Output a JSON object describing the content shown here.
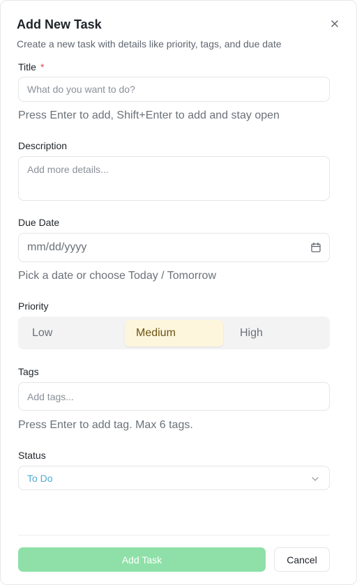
{
  "dialog": {
    "title": "Add New Task",
    "subtitle": "Create a new task with details like priority, tags, and due date"
  },
  "title_field": {
    "label": "Title",
    "required_marker": "*",
    "placeholder": "What do you want to do?",
    "hint": "Press Enter to add, Shift+Enter to add and stay open"
  },
  "description_field": {
    "label": "Description",
    "placeholder": "Add more details..."
  },
  "due_date_field": {
    "label": "Due Date",
    "placeholder": "mm/dd/yyyy",
    "hint": "Pick a date or choose Today / Tomorrow",
    "icon": "calendar-icon"
  },
  "priority": {
    "label": "Priority",
    "options": [
      "Low",
      "Medium",
      "High"
    ],
    "selected": "Medium"
  },
  "tags_field": {
    "label": "Tags",
    "placeholder": "Add tags...",
    "hint": "Press Enter to add tag. Max 6 tags."
  },
  "status_field": {
    "label": "Status",
    "value": "To Do",
    "icon": "chevron-down-icon"
  },
  "footer": {
    "submit_label": "Add Task",
    "cancel_label": "Cancel"
  },
  "colors": {
    "submit_button": "#8fe0a8",
    "priority_selected_bg": "#fdf6dc",
    "required_marker": "#e5484d",
    "status_value": "#4ea9d6"
  }
}
